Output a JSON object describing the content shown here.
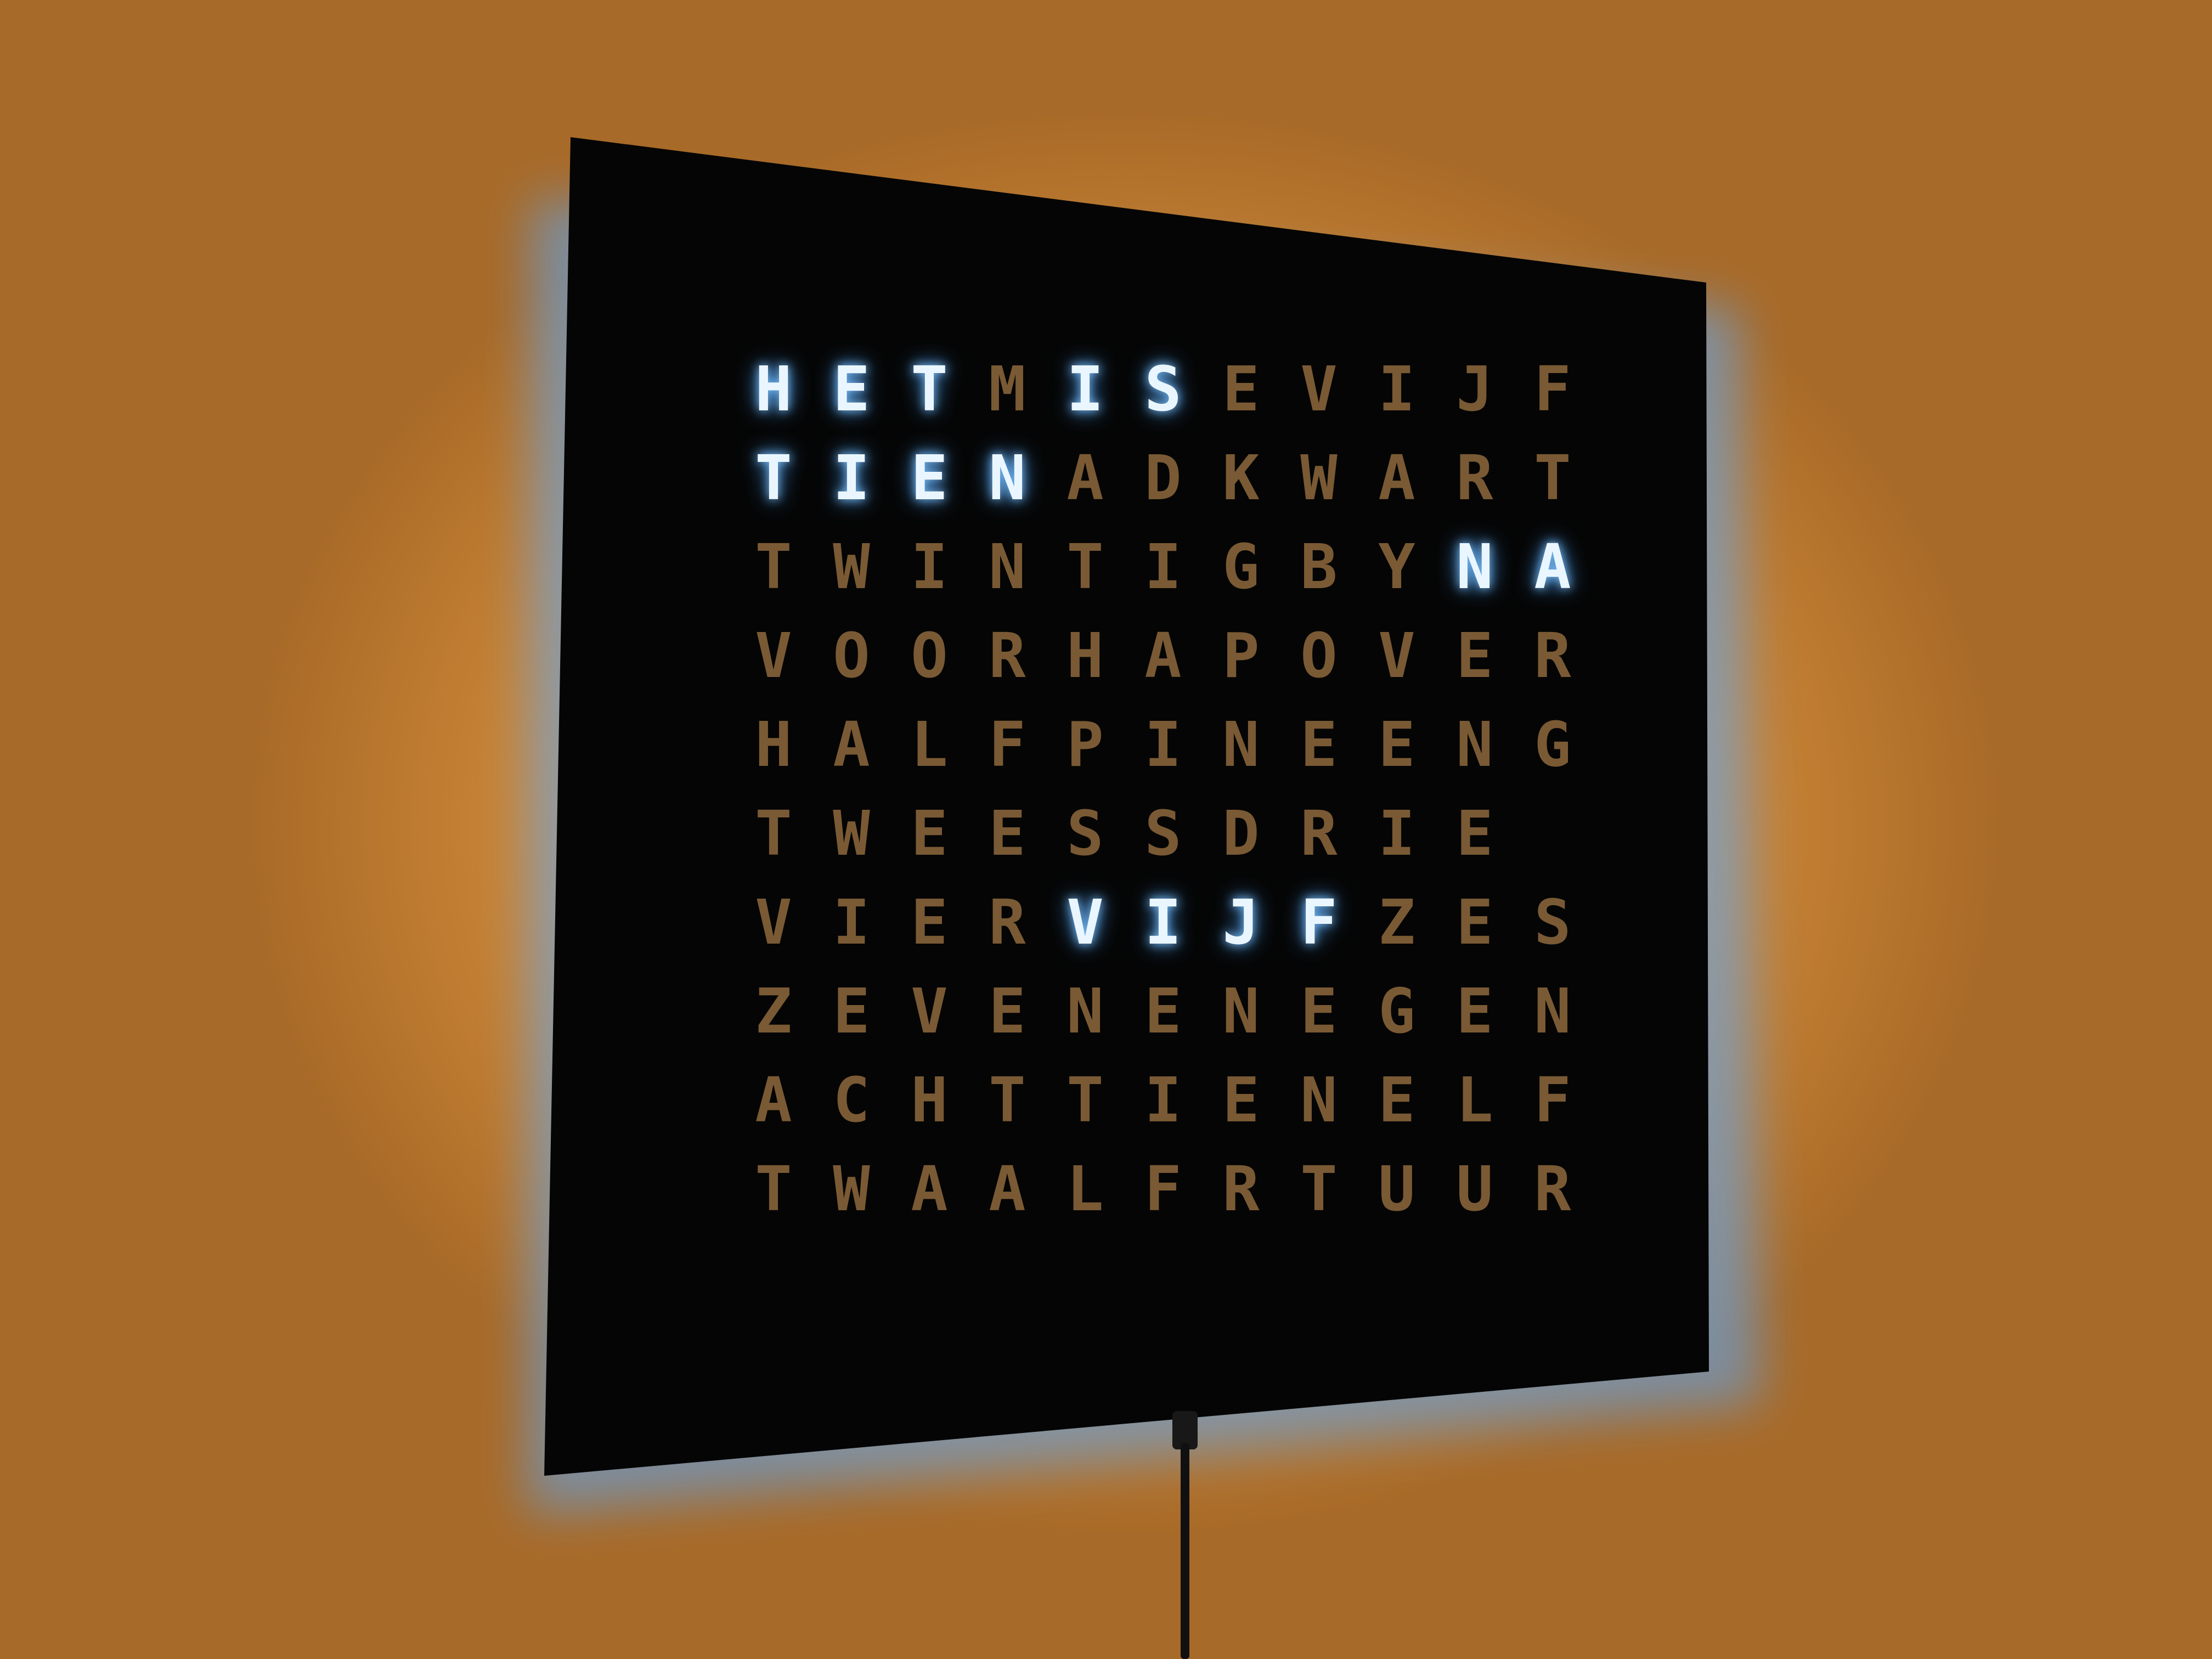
{
  "clock": {
    "rows": [
      [
        "H",
        "E",
        "T",
        "M",
        "I",
        "S",
        "E",
        "V",
        "I",
        "J",
        "F"
      ],
      [
        "T",
        "I",
        "E",
        "N",
        "A",
        "D",
        "K",
        "W",
        "A",
        "R",
        "T"
      ],
      [
        "T",
        "W",
        "I",
        "N",
        "T",
        "I",
        "G",
        "B",
        "Y",
        "N",
        "A"
      ],
      [
        "V",
        "O",
        "O",
        "R",
        "H",
        "A",
        "P",
        "O",
        "V",
        "E",
        "R"
      ],
      [
        "H",
        "A",
        "L",
        "F",
        "P",
        "I",
        "N",
        "E",
        "E",
        "N",
        "G"
      ],
      [
        "T",
        "W",
        "E",
        "E",
        "S",
        "S",
        "D",
        "R",
        "I",
        "E",
        ""
      ],
      [
        "V",
        "I",
        "E",
        "R",
        "V",
        "I",
        "J",
        "F",
        "Z",
        "E",
        "S"
      ],
      [
        "Z",
        "E",
        "V",
        "E",
        "N",
        "E",
        "N",
        "E",
        "G",
        "E",
        "N"
      ],
      [
        "A",
        "C",
        "H",
        "T",
        "T",
        "I",
        "E",
        "N",
        "E",
        "L",
        "F"
      ],
      [
        "T",
        "W",
        "A",
        "A",
        "L",
        "F",
        "R",
        "T",
        "U",
        "U",
        "R"
      ]
    ],
    "lit": [
      [
        0,
        0
      ],
      [
        0,
        1
      ],
      [
        0,
        2
      ],
      [
        0,
        4
      ],
      [
        0,
        5
      ],
      [
        1,
        0
      ],
      [
        1,
        1
      ],
      [
        1,
        2
      ],
      [
        1,
        3
      ],
      [
        2,
        9
      ],
      [
        2,
        10
      ],
      [
        6,
        4
      ],
      [
        6,
        5
      ],
      [
        6,
        6
      ],
      [
        6,
        7
      ]
    ],
    "colors": {
      "lit": "#eaf6ff",
      "dim": "#7a5a34",
      "backlight": "#5aaaff",
      "wall": "#e6a252",
      "panel": "#050505"
    }
  }
}
